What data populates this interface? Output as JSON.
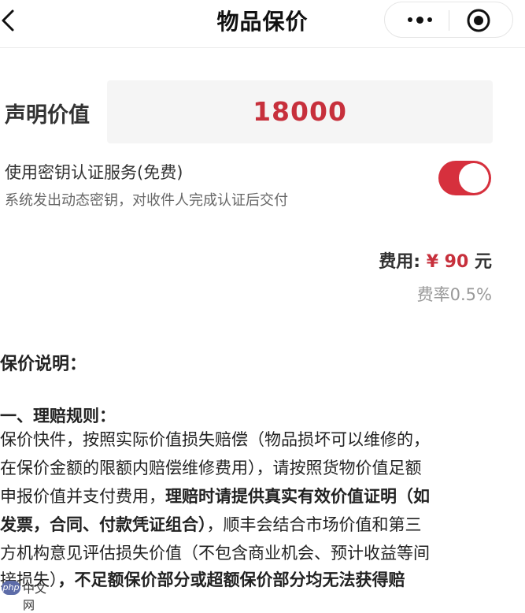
{
  "nav": {
    "title": "物品保价"
  },
  "declared": {
    "label": "声明价值",
    "value": "18000"
  },
  "service": {
    "title": "使用密钥认证服务(免费)",
    "desc": "系统发出动态密钥，对收件人完成认证后交付",
    "enabled": true
  },
  "fee": {
    "label": "费用:",
    "amount": "¥ 90",
    "unit": "元",
    "rate": "费率0.5%"
  },
  "notes": {
    "title": "保价说明：",
    "rule_title": "一、理赔规则：",
    "line1": "保价快件，按照实际价值损失赔偿（物品损坏可以维修的，",
    "line2": "在保价金额的限额内赔偿维修费用），请按照货物价值足额",
    "line3a": "申报价值并支付费用，",
    "line3b": "理赔时请提供真实有效价值证明（如",
    "line4a": "发票，合同、付款凭证组合）",
    "line4b": "，顺丰会结合市场价值和第三",
    "line5": "方机构意见评估损失价值（不包含商业机会、预计收益等间",
    "line6a": "接损失）",
    "line6b": "，不足额保价部分或超额保价部分均无法获得赔"
  },
  "watermark": {
    "logo": "php",
    "text": "中文网"
  },
  "colors": {
    "accent": "#c7303c",
    "toggle_on": "#d6303d"
  },
  "icons": [
    "back-icon",
    "more-icon",
    "target-icon"
  ]
}
